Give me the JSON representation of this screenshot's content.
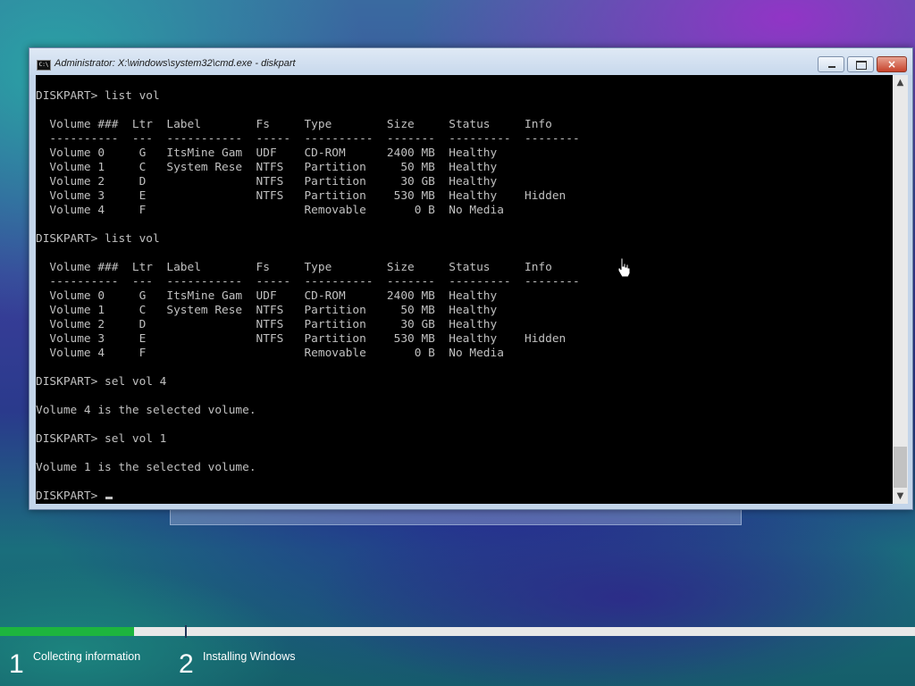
{
  "window": {
    "title": "Administrator: X:\\windows\\system32\\cmd.exe - diskpart",
    "app_icon": "C:\\",
    "controls": {
      "minimize": "minimize-icon",
      "maximize": "maximize-icon",
      "close": "×"
    }
  },
  "console": {
    "lines": [
      "DISKPART> list vol",
      "",
      "  Volume ###  Ltr  Label        Fs     Type        Size     Status     Info",
      "  ----------  ---  -----------  -----  ----------  -------  ---------  --------",
      "  Volume 0     G   ItsMine Gam  UDF    CD-ROM      2400 MB  Healthy",
      "  Volume 1     C   System Rese  NTFS   Partition     50 MB  Healthy",
      "  Volume 2     D                NTFS   Partition     30 GB  Healthy",
      "  Volume 3     E                NTFS   Partition    530 MB  Healthy    Hidden",
      "  Volume 4     F                       Removable       0 B  No Media",
      "",
      "DISKPART> list vol",
      "",
      "  Volume ###  Ltr  Label        Fs     Type        Size     Status     Info",
      "  ----------  ---  -----------  -----  ----------  -------  ---------  --------",
      "  Volume 0     G   ItsMine Gam  UDF    CD-ROM      2400 MB  Healthy",
      "  Volume 1     C   System Rese  NTFS   Partition     50 MB  Healthy",
      "  Volume 2     D                NTFS   Partition     30 GB  Healthy",
      "  Volume 3     E                NTFS   Partition    530 MB  Healthy    Hidden",
      "  Volume 4     F                       Removable       0 B  No Media",
      "",
      "DISKPART> sel vol 4",
      "",
      "Volume 4 is the selected volume.",
      "",
      "DISKPART> sel vol 1",
      "",
      "Volume 1 is the selected volume.",
      "",
      "DISKPART> "
    ]
  },
  "scrollbar": {
    "up": "▲",
    "down": "▼"
  },
  "setup": {
    "progress_fraction": 0.146,
    "progress_color": "#1db53e",
    "stages": [
      {
        "number": "1",
        "label": "Collecting information"
      },
      {
        "number": "2",
        "label": "Installing Windows"
      }
    ]
  }
}
